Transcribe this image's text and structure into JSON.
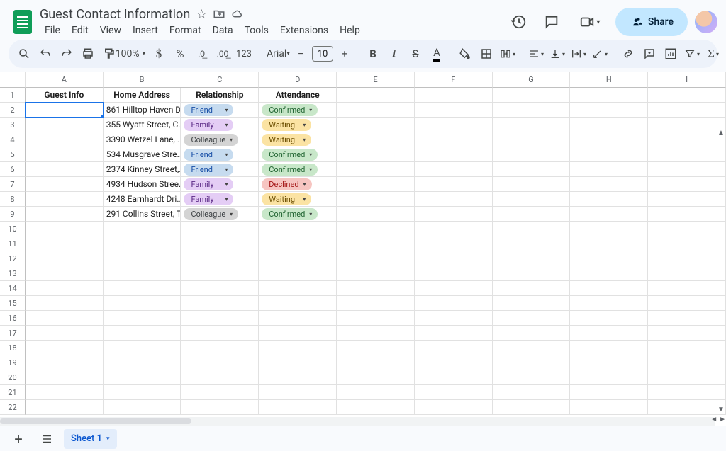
{
  "doc": {
    "title": "Guest Contact Information"
  },
  "menus": [
    "File",
    "Edit",
    "View",
    "Insert",
    "Format",
    "Data",
    "Tools",
    "Extensions",
    "Help"
  ],
  "share": "Share",
  "zoom": "100%",
  "font": "Arial",
  "fontSize": "10",
  "cols": [
    "A",
    "B",
    "C",
    "D",
    "E",
    "F",
    "G",
    "H",
    "I"
  ],
  "headers": {
    "A": "Guest Info",
    "B": "Home Address",
    "C": "Relationship",
    "D": "Attendance"
  },
  "rows": [
    {
      "n": 2,
      "addr": "861 Hilltop Haven D...",
      "rel": "Friend",
      "att": "Confirmed"
    },
    {
      "n": 3,
      "addr": "355 Wyatt Street, C...",
      "rel": "Family",
      "att": "Waiting"
    },
    {
      "n": 4,
      "addr": "3390 Wetzel Lane, ...",
      "rel": "Colleague",
      "att": "Waiting"
    },
    {
      "n": 5,
      "addr": "534 Musgrave Stre...",
      "rel": "Friend",
      "att": "Confirmed"
    },
    {
      "n": 6,
      "addr": "2374 Kinney Street,...",
      "rel": "Friend",
      "att": "Confirmed"
    },
    {
      "n": 7,
      "addr": "4934 Hudson Stree...",
      "rel": "Family",
      "att": "Declined"
    },
    {
      "n": 8,
      "addr": "4248 Earnhardt Dri...",
      "rel": "Family",
      "att": "Waiting"
    },
    {
      "n": 9,
      "addr": "291 Collins Street, T...",
      "rel": "Colleague",
      "att": "Confirmed"
    }
  ],
  "blankRows": [
    10,
    11,
    12,
    13,
    14,
    15,
    16,
    17,
    18,
    19,
    20,
    21,
    22
  ],
  "sheetTab": "Sheet 1",
  "chipArrow": "▾"
}
